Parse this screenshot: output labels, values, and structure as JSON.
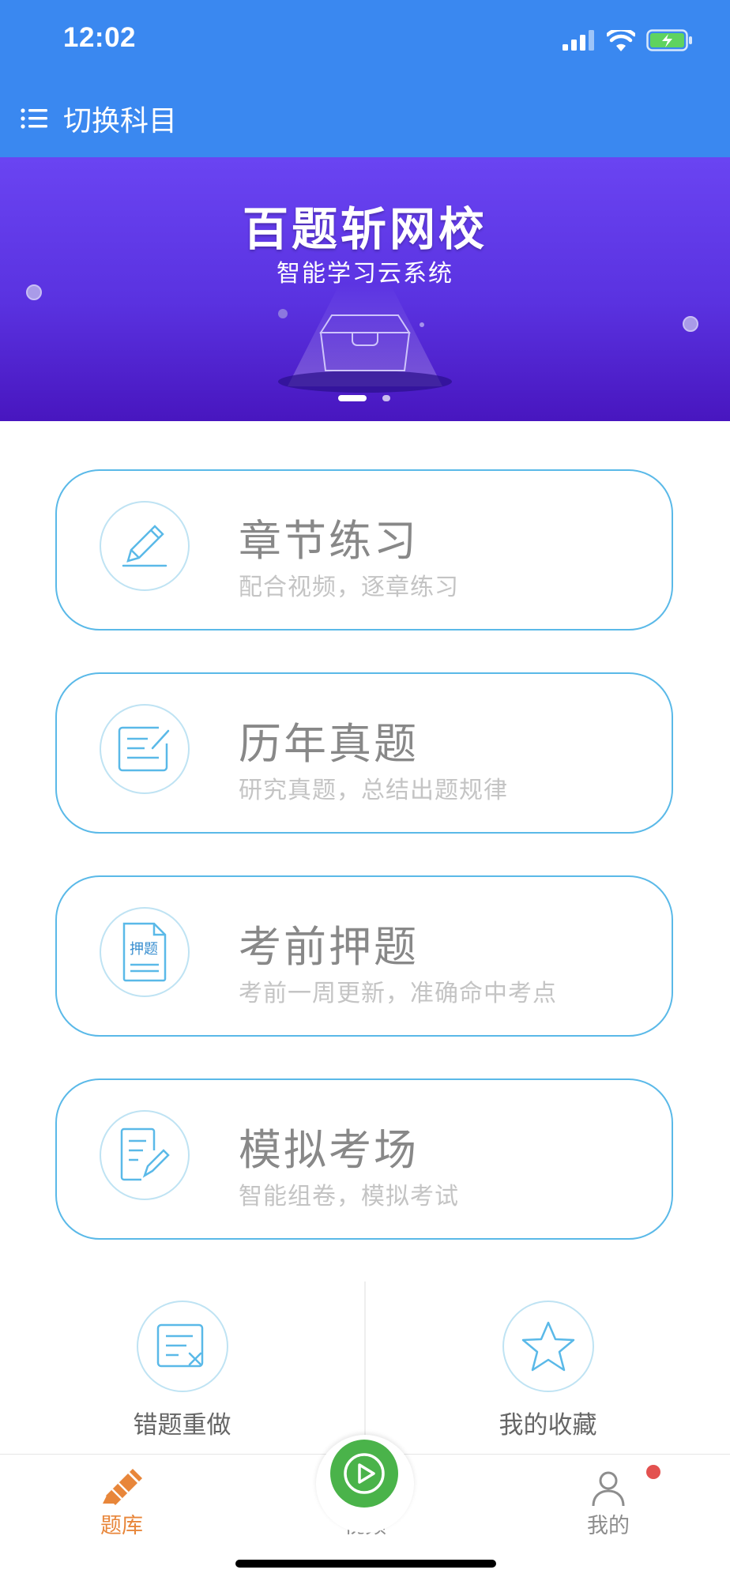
{
  "status_bar": {
    "time": "12:02"
  },
  "header": {
    "title": "切换科目",
    "accent": "#3a88f0"
  },
  "banner": {
    "title": "百题斩网校",
    "subtitle": "智能学习云系统",
    "slide_count": 2,
    "active_slide": 1
  },
  "menu": [
    {
      "title": "章节练习",
      "subtitle": "配合视频，逐章练习",
      "icon": "pencil-icon"
    },
    {
      "title": "历年真题",
      "subtitle": "研究真题，总结出题规律",
      "icon": "document-edit-icon"
    },
    {
      "title": "考前押题",
      "subtitle": "考前一周更新，准确命中考点",
      "icon": "exam-paper-icon",
      "icon_text": "押题"
    },
    {
      "title": "模拟考场",
      "subtitle": "智能组卷，模拟考试",
      "icon": "exam-sheet-icon"
    }
  ],
  "quick_actions": [
    {
      "label": "错题重做",
      "icon": "wrong-answer-icon"
    },
    {
      "label": "我的收藏",
      "icon": "star-icon"
    }
  ],
  "tabs": [
    {
      "label": "题库",
      "icon": "question-bank-icon",
      "active": true
    },
    {
      "label": "视频",
      "icon": "play-icon",
      "active": false
    },
    {
      "label": "我的",
      "icon": "user-icon",
      "active": false,
      "badge": true
    }
  ],
  "colors": {
    "card_border": "#5ab9e8",
    "tab_active": "#e8863a",
    "video_button": "#4ab34a",
    "badge": "#e3514f"
  }
}
